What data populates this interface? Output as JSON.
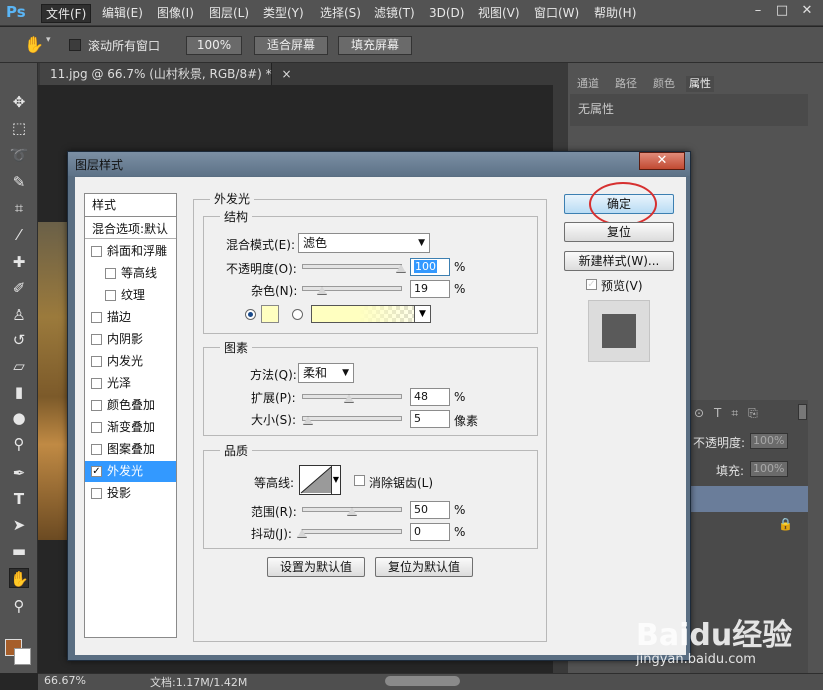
{
  "app": {
    "logo": "Ps"
  },
  "menu": {
    "items": [
      "文件(F)",
      "编辑(E)",
      "图像(I)",
      "图层(L)",
      "类型(Y)",
      "选择(S)",
      "滤镜(T)",
      "3D(D)",
      "视图(V)",
      "窗口(W)",
      "帮助(H)"
    ],
    "active_index": 0
  },
  "options": {
    "scroll_all_label": "滚动所有窗口",
    "zoom_100": "100%",
    "fit_screen": "适合屏幕",
    "fill_screen": "填充屏幕"
  },
  "document": {
    "tab_title": "11.jpg @ 66.7% (山村秋景, RGB/8#) *",
    "tab_close": "×"
  },
  "panels": {
    "tabs": [
      "通道",
      "路径",
      "颜色",
      "属性"
    ],
    "properties_text": "无属性",
    "layers": {
      "opacity_label": "不透明度:",
      "opacity_value": "100%",
      "fill_label": "填充:",
      "fill_value": "100%"
    }
  },
  "status": {
    "zoom": "66.67%",
    "doc_info": "文档:1.17M/1.42M"
  },
  "dialog": {
    "title": "图层样式",
    "style_list": {
      "header": "样式",
      "blend_options": "混合选项:默认",
      "items": [
        {
          "label": "斜面和浮雕",
          "checked": false,
          "indent": false
        },
        {
          "label": "等高线",
          "checked": false,
          "indent": true
        },
        {
          "label": "纹理",
          "checked": false,
          "indent": true
        },
        {
          "label": "描边",
          "checked": false,
          "indent": false
        },
        {
          "label": "内阴影",
          "checked": false,
          "indent": false
        },
        {
          "label": "内发光",
          "checked": false,
          "indent": false
        },
        {
          "label": "光泽",
          "checked": false,
          "indent": false
        },
        {
          "label": "颜色叠加",
          "checked": false,
          "indent": false
        },
        {
          "label": "渐变叠加",
          "checked": false,
          "indent": false
        },
        {
          "label": "图案叠加",
          "checked": false,
          "indent": false
        },
        {
          "label": "外发光",
          "checked": true,
          "indent": false,
          "selected": true
        },
        {
          "label": "投影",
          "checked": false,
          "indent": false
        }
      ]
    },
    "outer_glow": {
      "title": "外发光",
      "structure": {
        "title": "结构",
        "blend_mode_label": "混合模式(E):",
        "blend_mode_value": "滤色",
        "opacity_label": "不透明度(O):",
        "opacity_value": "100",
        "noise_label": "杂色(N):",
        "noise_value": "19",
        "percent": "%",
        "glow_color": "#ffffc0"
      },
      "elements": {
        "title": "图素",
        "technique_label": "方法(Q):",
        "technique_value": "柔和",
        "spread_label": "扩展(P):",
        "spread_value": "48",
        "size_label": "大小(S):",
        "size_value": "5",
        "size_unit": "像素"
      },
      "quality": {
        "title": "品质",
        "contour_label": "等高线:",
        "antialias_label": "消除锯齿(L)",
        "range_label": "范围(R):",
        "range_value": "50",
        "jitter_label": "抖动(J):",
        "jitter_value": "0"
      },
      "make_default": "设置为默认值",
      "reset_default": "复位为默认值"
    },
    "buttons": {
      "ok": "确定",
      "reset": "复位",
      "new_style": "新建样式(W)...",
      "preview_label": "预览(V)",
      "preview_checked": true
    }
  },
  "watermark": {
    "logo": "Baidu经验",
    "sub": "jingyan.baidu.com"
  }
}
